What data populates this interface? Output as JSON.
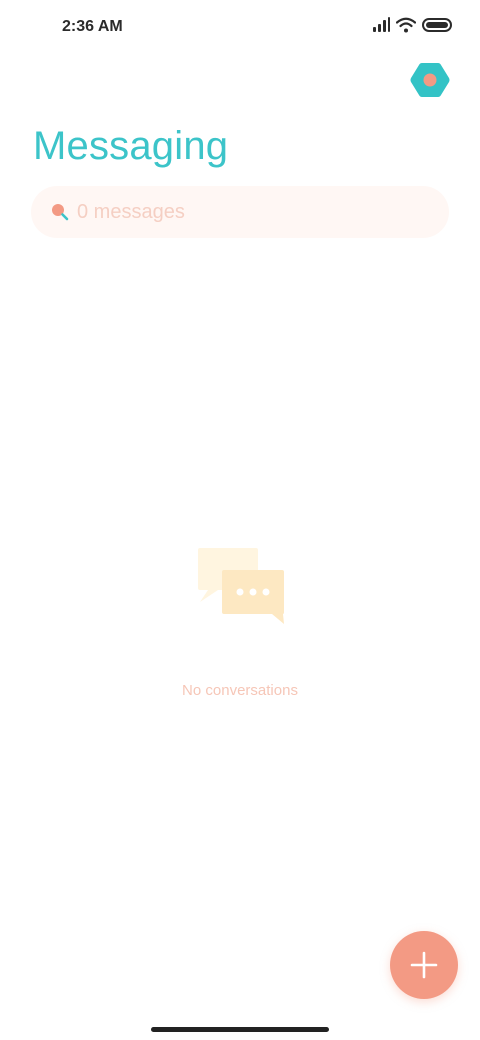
{
  "status_bar": {
    "time": "2:36 AM"
  },
  "header": {
    "title": "Messaging",
    "settings_icon": "gear-icon"
  },
  "search": {
    "placeholder": "0 messages",
    "value": ""
  },
  "empty_state": {
    "text": "No conversations",
    "icon": "chat-bubbles-icon"
  },
  "fab": {
    "icon": "plus-icon"
  },
  "colors": {
    "accent": "#3cc4c9",
    "primary_action": "#f39a84",
    "search_bg": "#fff7f4",
    "muted_text": "#f6c6b7",
    "illustration_back": "#fff5e0",
    "illustration_front": "#fde8c2"
  }
}
